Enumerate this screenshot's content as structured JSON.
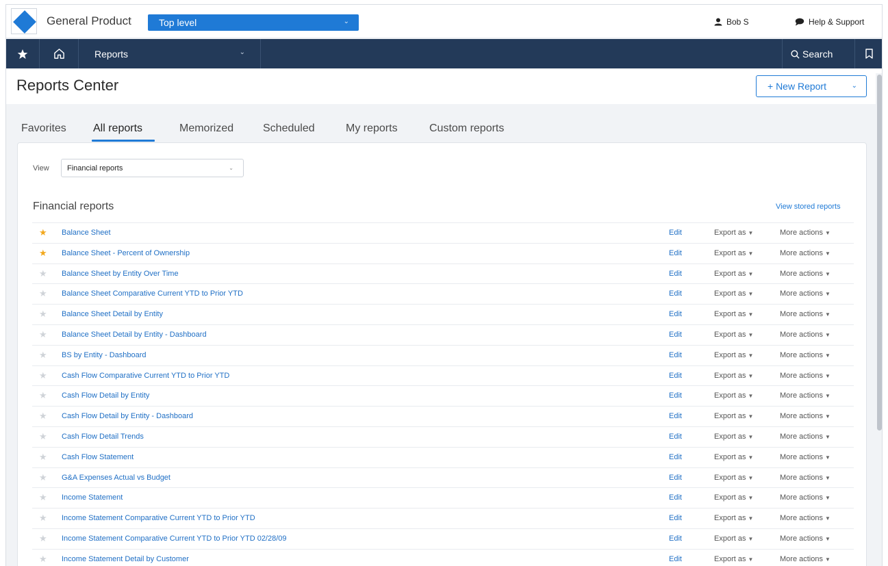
{
  "topbar": {
    "product": "General Product",
    "entity": "Top level",
    "user": "Bob S",
    "help": "Help & Support"
  },
  "nav": {
    "module": "Reports",
    "search": "Search"
  },
  "header": {
    "title": "Reports Center",
    "new_report": "+ New Report"
  },
  "tabs": [
    "Favorites",
    "All reports",
    "Memorized",
    "Scheduled",
    "My reports",
    "Custom reports"
  ],
  "active_tab": "All reports",
  "view": {
    "label": "View",
    "selected": "Financial reports"
  },
  "section": {
    "title": "Financial reports",
    "stored_link": "View stored reports"
  },
  "row_actions": {
    "edit": "Edit",
    "export": "Export as",
    "more": "More actions"
  },
  "reports": [
    {
      "name": "Balance Sheet",
      "favorite": true
    },
    {
      "name": "Balance Sheet - Percent of Ownership",
      "favorite": true
    },
    {
      "name": "Balance Sheet by Entity Over Time",
      "favorite": false
    },
    {
      "name": "Balance Sheet Comparative Current YTD to Prior YTD",
      "favorite": false
    },
    {
      "name": "Balance Sheet Detail by Entity",
      "favorite": false
    },
    {
      "name": "Balance Sheet Detail by Entity - Dashboard",
      "favorite": false
    },
    {
      "name": "BS by Entity - Dashboard",
      "favorite": false
    },
    {
      "name": "Cash Flow Comparative Current YTD to Prior YTD",
      "favorite": false
    },
    {
      "name": "Cash Flow Detail by Entity",
      "favorite": false
    },
    {
      "name": "Cash Flow Detail by Entity - Dashboard",
      "favorite": false
    },
    {
      "name": "Cash Flow Detail Trends",
      "favorite": false
    },
    {
      "name": "Cash Flow Statement",
      "favorite": false
    },
    {
      "name": "G&A Expenses Actual vs Budget",
      "favorite": false
    },
    {
      "name": "Income Statement",
      "favorite": false
    },
    {
      "name": "Income Statement Comparative Current YTD to Prior YTD",
      "favorite": false
    },
    {
      "name": "Income Statement Comparative Current YTD to Prior YTD 02/28/09",
      "favorite": false
    },
    {
      "name": "Income Statement Detail by Customer",
      "favorite": false
    }
  ],
  "colors": {
    "accent": "#1f7ad6",
    "nav_bg": "#233a59",
    "favorite_star": "#f2a81d",
    "inactive_star": "#cfd3d8",
    "link": "#1f6fc5"
  },
  "icons": {
    "logo": "diamond-logo-icon",
    "user": "user-icon",
    "help": "chat-bubble-icon",
    "favorites": "star-icon",
    "home": "home-icon",
    "search": "search-icon",
    "bookmark": "bookmark-icon"
  }
}
